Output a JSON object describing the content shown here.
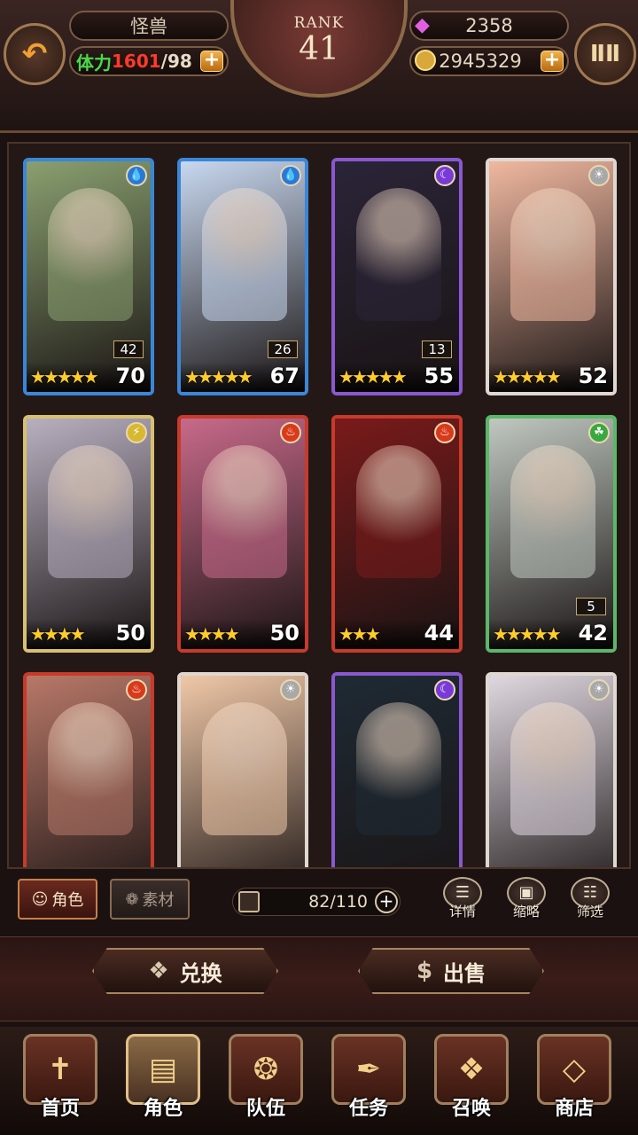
{
  "header": {
    "player_name": "怪兽",
    "stamina_label": "体力",
    "stamina_current": "1601",
    "stamina_max": "/98",
    "plus": "+",
    "gems": "2358",
    "gold": "2945329",
    "rank_label": "RANK",
    "rank_value": "41",
    "back_icon": "back-arrow-icon",
    "menu_icon": "temple-icon"
  },
  "cards": [
    {
      "stars": "★★★★★",
      "level": "70",
      "count": "42",
      "element": "water",
      "elem_color": "#2a78d8",
      "frame": "#3a86d8",
      "bg": "#8aa070"
    },
    {
      "stars": "★★★★★",
      "level": "67",
      "count": "26",
      "element": "water",
      "elem_color": "#2a78d8",
      "frame": "#3a86d8",
      "bg": "#c8d8f0"
    },
    {
      "stars": "★★★★★",
      "level": "55",
      "count": "13",
      "element": "dark",
      "elem_color": "#7a3ad8",
      "frame": "#8a58d0",
      "bg": "#2a2438"
    },
    {
      "stars": "★★★★★",
      "level": "52",
      "count": "",
      "element": "light",
      "elem_color": "#a8a8a8",
      "frame": "#e0d8d0",
      "bg": "#f0b8a0"
    },
    {
      "stars": "★★★★",
      "level": "50",
      "count": "",
      "element": "thunder",
      "elem_color": "#d8b830",
      "frame": "#d8c070",
      "bg": "#b8b0c0"
    },
    {
      "stars": "★★★★",
      "level": "50",
      "count": "",
      "element": "fire",
      "elem_color": "#d83a1a",
      "frame": "#c83a2a",
      "bg": "#c86a8a"
    },
    {
      "stars": "★★★",
      "level": "44",
      "count": "",
      "element": "fire",
      "elem_color": "#d83a1a",
      "frame": "#c83a2a",
      "bg": "#7a1a1a"
    },
    {
      "stars": "★★★★★",
      "level": "42",
      "count": "5",
      "element": "wind",
      "elem_color": "#3aa840",
      "frame": "#5ab86a",
      "bg": "#c0c8c0"
    },
    {
      "stars": "",
      "level": "",
      "count": "",
      "element": "fire",
      "elem_color": "#d83a1a",
      "frame": "#c83a2a",
      "bg": "#b87868"
    },
    {
      "stars": "",
      "level": "",
      "count": "",
      "element": "light",
      "elem_color": "#a8a8a8",
      "frame": "#e0d8d0",
      "bg": "#f0c8a8"
    },
    {
      "stars": "",
      "level": "",
      "count": "",
      "element": "dark",
      "elem_color": "#7a3ad8",
      "frame": "#8a58d0",
      "bg": "#1e2a34"
    },
    {
      "stars": "",
      "level": "",
      "count": "",
      "element": "light",
      "elem_color": "#a8a8a8",
      "frame": "#e0d8d0",
      "bg": "#e0d8e0"
    }
  ],
  "toolbar": {
    "tab_role": "角色",
    "tab_material": "素材",
    "capacity": "82/110",
    "capacity_plus": "+",
    "details": "详情",
    "thumbnail": "缩略",
    "filter": "筛选"
  },
  "actions": {
    "exchange": "兑换",
    "sell": "出售"
  },
  "nav": {
    "home": "首页",
    "role": "角色",
    "team": "队伍",
    "quest": "任务",
    "summon": "召唤",
    "shop": "商店"
  }
}
